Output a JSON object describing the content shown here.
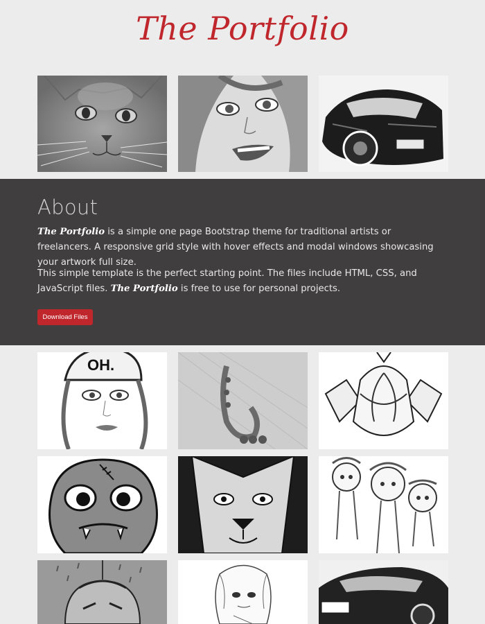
{
  "header": {
    "brand": "The Portfolio"
  },
  "about": {
    "heading": "About",
    "brand_inline": "The Portfolio",
    "p1_text": " is a simple one page Bootstrap theme for traditional artists or freelancers. A responsive grid style with hover effects and modal windows showcasing your artwork full size.",
    "p2_text_a": "This simple template is the perfect starting point. The files include HTML, CSS, and JavaScript files. ",
    "brand_inline_2": "The Portfolio",
    "p2_text_b": " is free to use for personal projects.",
    "download_label": "Download Files"
  },
  "colors": {
    "brand_red": "#c0272d",
    "about_bg": "#403e3e",
    "page_bg": "#ececec"
  },
  "gallery": [
    {
      "name": "cat-drawing"
    },
    {
      "name": "girl-portrait-drawing"
    },
    {
      "name": "sports-car-drawing"
    },
    {
      "name": "girl-beanie-drawing"
    },
    {
      "name": "saxophone-drawing"
    },
    {
      "name": "flower-drawing"
    },
    {
      "name": "monster-drawing"
    },
    {
      "name": "lion-drawing"
    },
    {
      "name": "cartoon-girls-drawing"
    },
    {
      "name": "rain-face-drawing"
    },
    {
      "name": "anime-girl-drawing"
    },
    {
      "name": "car-drawing"
    }
  ]
}
